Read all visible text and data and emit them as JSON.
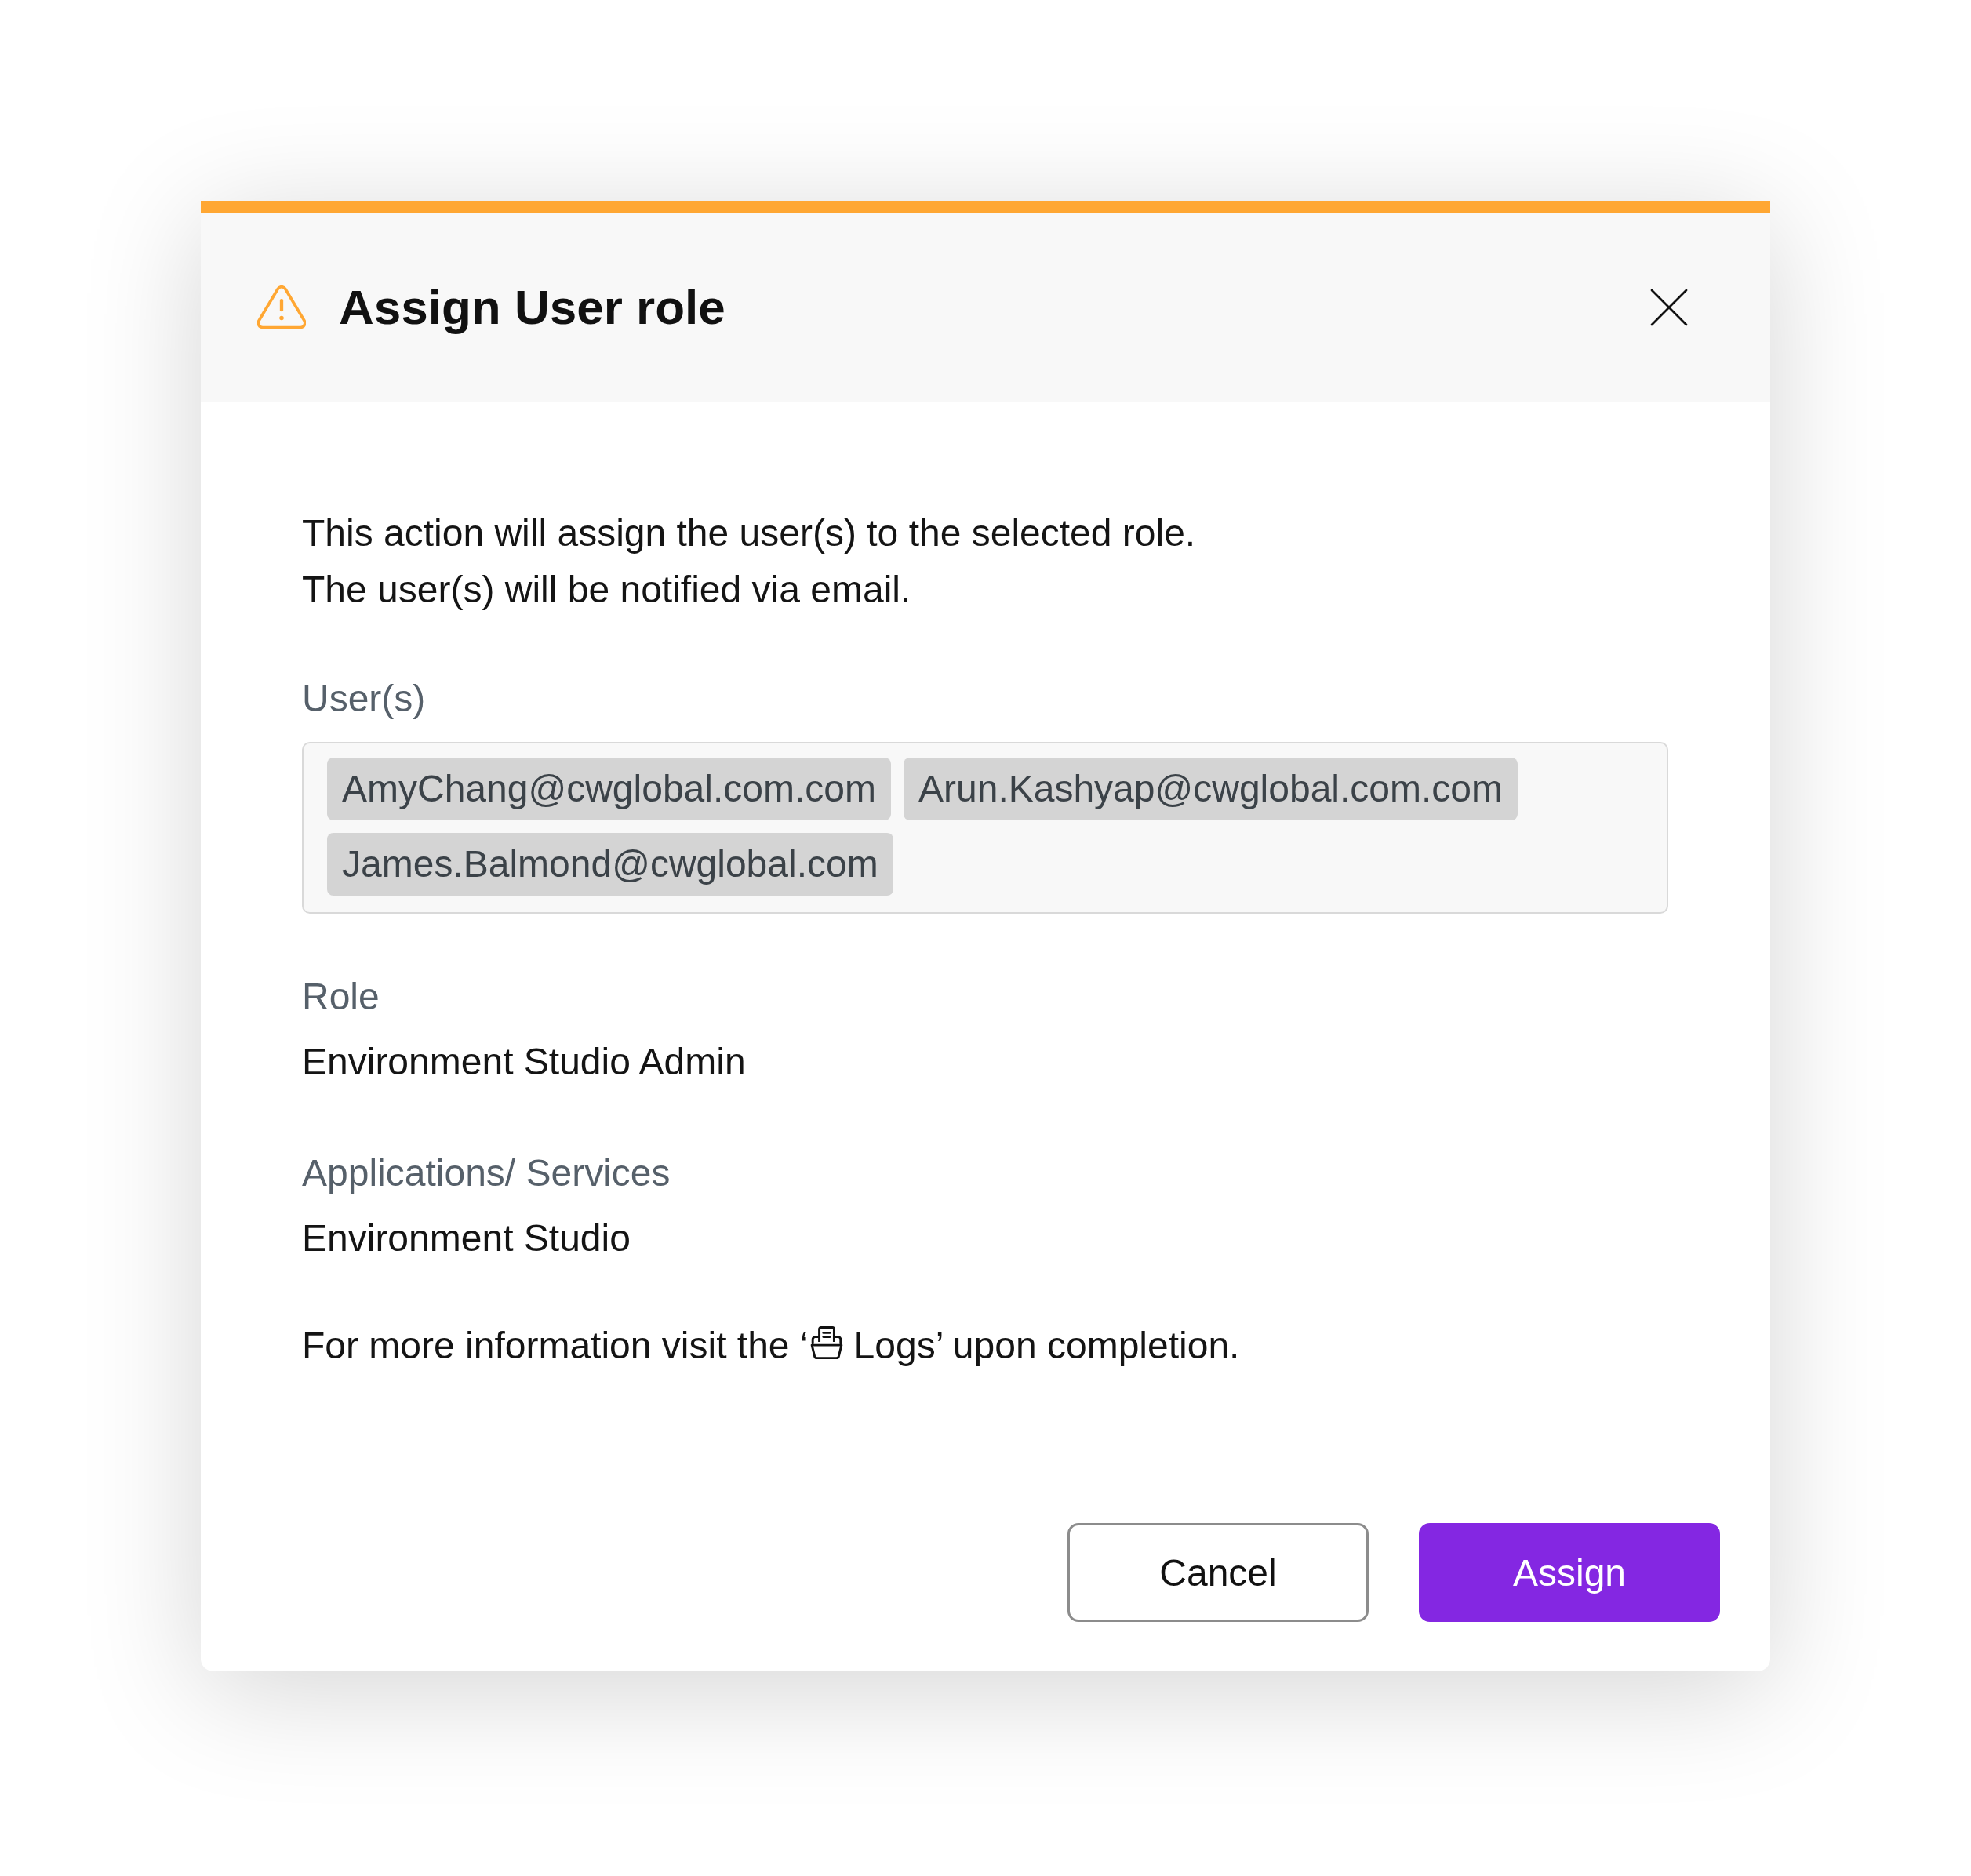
{
  "dialog": {
    "kind": "warning",
    "title": "Assign User role"
  },
  "description": [
    "This action will assign the user(s) to the selected role.",
    "The user(s) will be notified via email."
  ],
  "users": {
    "label": "User(s)",
    "tags": [
      "AmyChang@cwglobal.com.com",
      "Arun.Kashyap@cwglobal.com.com",
      "James.Balmond@cwglobal.com"
    ]
  },
  "details": [
    {
      "label": "Role",
      "value": "Environment Studio Admin"
    },
    {
      "label": "Applications/ Services",
      "value": "Environment Studio"
    }
  ],
  "info": {
    "text_before_icon": "For more information visit the ‘",
    "text_after_icon": "Logs’ upon completion."
  },
  "buttons": [
    {
      "label": "Cancel",
      "kind": "secondary"
    },
    {
      "label": "Assign",
      "kind": "primary"
    }
  ]
}
